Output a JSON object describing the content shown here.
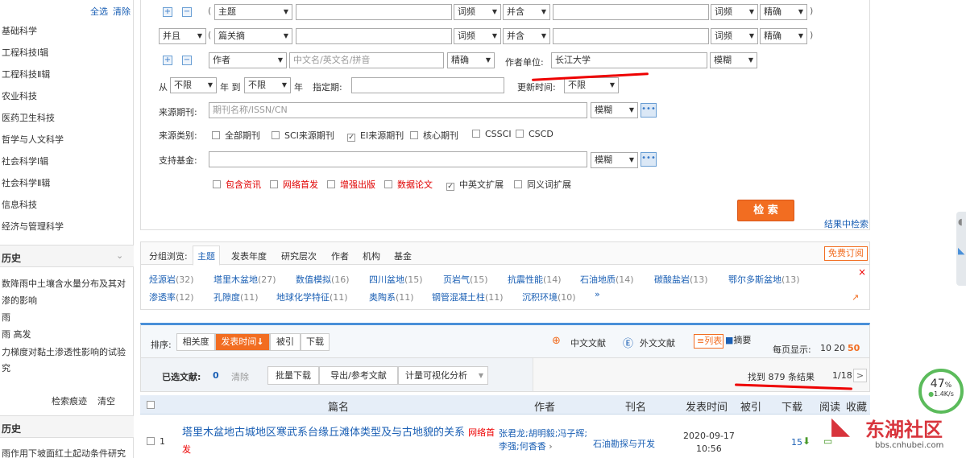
{
  "sidebar": {
    "select_all": "全选",
    "clear": "清除",
    "categories": [
      "基础科学",
      "工程科技Ⅰ辑",
      "工程科技Ⅱ辑",
      "农业科技",
      "医药卫生科技",
      "哲学与人文科学",
      "社会科学Ⅰ辑",
      "社会科学Ⅱ辑",
      "信息科技",
      "经济与管理科学"
    ],
    "history_title": "历史",
    "history_items": [
      "数降雨中土壤含水量分布及其对",
      "渗的影响",
      "雨",
      "雨 高发",
      "力梯度对黏土渗透性影响的试验",
      "究"
    ],
    "history_actions": [
      "检索痕迹",
      "清空"
    ],
    "history2_title": "历史",
    "history2_item": "雨作用下坡面红土起动条件研究"
  },
  "search": {
    "row1": {
      "field": "主题",
      "match1": "词频",
      "logic": "并含",
      "match2": "词频",
      "precision": "精确"
    },
    "row2": {
      "bool": "并且",
      "field": "篇关摘",
      "match1": "词频",
      "logic": "并含",
      "match2": "词频",
      "precision": "精确"
    },
    "row3": {
      "field": "作者",
      "author_placeholder": "中文名/英文名/拼音",
      "author_precision": "精确",
      "unit_label": "作者单位:",
      "unit_value": "长江大学",
      "unit_precision": "模糊"
    },
    "row4": {
      "from": "从",
      "from_val": "不限",
      "year_to": "年 到",
      "to_val": "不限",
      "year": "年",
      "specified": "指定期:",
      "update_label": "更新时间:",
      "update_val": "不限"
    },
    "source_label": "来源期刊:",
    "source_placeholder": "期刊名称/ISSN/CN",
    "source_match": "模糊",
    "category_label": "来源类别:",
    "categories": [
      {
        "label": "全部期刊",
        "checked": false
      },
      {
        "label": "SCI来源期刊",
        "checked": false
      },
      {
        "label": "EI来源期刊",
        "checked": true
      },
      {
        "label": "核心期刊",
        "checked": false
      },
      {
        "label": "CSSCI",
        "checked": false
      },
      {
        "label": "CSCD",
        "checked": false
      }
    ],
    "fund_label": "支持基金:",
    "fund_match": "模糊",
    "extras": [
      {
        "label": "包含资讯",
        "checked": false,
        "red": true
      },
      {
        "label": "网络首发",
        "checked": false,
        "red": true
      },
      {
        "label": "增强出版",
        "checked": false,
        "red": true
      },
      {
        "label": "数据论文",
        "checked": false,
        "red": true
      },
      {
        "label": "中英文扩展",
        "checked": true,
        "red": false
      },
      {
        "label": "同义词扩展",
        "checked": false,
        "red": false
      }
    ],
    "search_button": "检 索",
    "result_search": "结果中检索"
  },
  "group": {
    "label": "分组浏览:",
    "tabs": [
      "主题",
      "发表年度",
      "研究层次",
      "作者",
      "机构",
      "基金"
    ],
    "subscribe": "免费订阅",
    "tags_row1": [
      [
        "烃源岩",
        "(32)"
      ],
      [
        "塔里木盆地",
        "(27)"
      ],
      [
        "数值模拟",
        "(16)"
      ],
      [
        "四川盆地",
        "(15)"
      ],
      [
        "页岩气",
        "(15)"
      ],
      [
        "抗震性能",
        "(14)"
      ],
      [
        "石油地质",
        "(14)"
      ],
      [
        "碳酸盐岩",
        "(13)"
      ],
      [
        "鄂尔多斯盆地",
        "(13)"
      ]
    ],
    "tags_row2": [
      [
        "渗透率",
        "(12)"
      ],
      [
        "孔隙度",
        "(11)"
      ],
      [
        "地球化学特征",
        "(11)"
      ],
      [
        "奥陶系",
        "(11)"
      ],
      [
        "钢管混凝土柱",
        "(11)"
      ],
      [
        "沉积环境",
        "(10)"
      ]
    ],
    "more": "»"
  },
  "sort": {
    "label": "排序:",
    "options": [
      "相关度",
      "发表时间",
      "被引",
      "下载"
    ],
    "active": "发表时间",
    "lang": [
      "中文文献",
      "外文文献"
    ],
    "views": [
      "列表",
      "摘要"
    ],
    "per_page_label": "每页显示:",
    "per_page": [
      "10",
      "20",
      "50"
    ]
  },
  "selected": {
    "label": "已选文献:",
    "count": "0",
    "clear": "清除",
    "actions": [
      "批量下载",
      "导出/参考文献",
      "计量可视化分析"
    ],
    "found": "找到 879 条结果",
    "page": "1/18",
    "next": ">"
  },
  "table": {
    "headers": [
      "篇名",
      "作者",
      "刊名",
      "发表时间",
      "被引",
      "下载",
      "阅读",
      "收藏"
    ],
    "rows": [
      {
        "num": "1",
        "title": "塔里木盆地古城地区寒武系台缘丘滩体类型及与古地貌的关系",
        "tag": "网络首发",
        "authors": "张君龙;胡明毅;冯子辉;李强;何香香",
        "journal": "石油勘探与开发",
        "date": "2020-09-17",
        "time": "10:56",
        "cite": "",
        "download": "15"
      }
    ]
  },
  "widget": {
    "percent": "47",
    "unit": "%",
    "speed": "1.4K/s"
  },
  "watermark": {
    "name": "东湖社区",
    "url": "bbs.cnhubei.com"
  },
  "colors": {
    "accent": "#f26d21",
    "link": "#1a5fb4",
    "red": "#e00000"
  }
}
